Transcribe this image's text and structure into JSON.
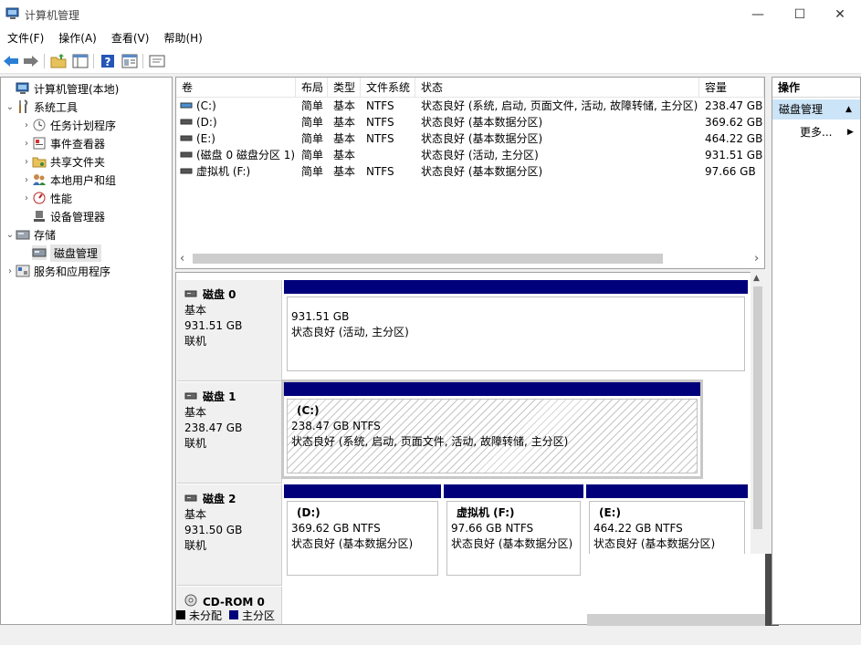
{
  "window": {
    "title": "计算机管理",
    "minimize_glyph": "—",
    "maximize_glyph": "☐",
    "close_glyph": "✕"
  },
  "menu": [
    "文件(F)",
    "操作(A)",
    "查看(V)",
    "帮助(H)"
  ],
  "toolbar": {
    "icons": [
      "back-arrow-icon",
      "forward-arrow-icon",
      "up-folder-icon",
      "show-hide-tree-icon",
      "help-icon",
      "properties-icon",
      "console-icon"
    ]
  },
  "tree": [
    {
      "label": "计算机管理(本地)",
      "chev": "",
      "icon": "computer-management-icon"
    },
    {
      "label": "系统工具",
      "chev": "⌄",
      "icon": "tools-icon"
    },
    {
      "label": "任务计划程序",
      "chev": "›",
      "icon": "clock-icon"
    },
    {
      "label": "事件查看器",
      "chev": "›",
      "icon": "event-viewer-icon"
    },
    {
      "label": "共享文件夹",
      "chev": "›",
      "icon": "shared-folder-icon"
    },
    {
      "label": "本地用户和组",
      "chev": "›",
      "icon": "users-icon"
    },
    {
      "label": "性能",
      "chev": "›",
      "icon": "performance-icon"
    },
    {
      "label": "设备管理器",
      "chev": "",
      "icon": "device-manager-icon"
    },
    {
      "label": "存储",
      "chev": "⌄",
      "icon": "storage-icon"
    },
    {
      "label": "磁盘管理",
      "chev": "",
      "icon": "disk-management-icon"
    },
    {
      "label": "服务和应用程序",
      "chev": "›",
      "icon": "services-icon"
    }
  ],
  "volumes": {
    "headers": [
      "卷",
      "布局",
      "类型",
      "文件系统",
      "状态",
      "容量"
    ],
    "rows": [
      [
        "(C:)",
        "简单",
        "基本",
        "NTFS",
        "状态良好 (系统, 启动, 页面文件, 活动, 故障转储, 主分区)",
        "238.47 GB"
      ],
      [
        "(D:)",
        "简单",
        "基本",
        "NTFS",
        "状态良好 (基本数据分区)",
        "369.62 GB"
      ],
      [
        "(E:)",
        "简单",
        "基本",
        "NTFS",
        "状态良好 (基本数据分区)",
        "464.22 GB"
      ],
      [
        "(磁盘 0 磁盘分区 1)",
        "简单",
        "基本",
        "",
        "状态良好 (活动, 主分区)",
        "931.51 GB"
      ],
      [
        "虚拟机 (F:)",
        "简单",
        "基本",
        "NTFS",
        "状态良好 (基本数据分区)",
        "97.66 GB"
      ]
    ],
    "scroll_left": "‹",
    "scroll_right": "›"
  },
  "disks": [
    {
      "name": "磁盘 0",
      "type": "基本",
      "size": "931.51 GB",
      "status": "联机",
      "partitions": [
        {
          "name": "",
          "size": "931.51 GB",
          "status": "状态良好 (活动, 主分区)"
        }
      ]
    },
    {
      "name": "磁盘 1",
      "type": "基本",
      "size": "238.47 GB",
      "status": "联机",
      "partitions": [
        {
          "name": "(C:)",
          "size": "238.47 GB NTFS",
          "status": "状态良好 (系统, 启动, 页面文件, 活动, 故障转储, 主分区)"
        }
      ]
    },
    {
      "name": "磁盘 2",
      "type": "基本",
      "size": "931.50 GB",
      "status": "联机",
      "partitions": [
        {
          "name": "(D:)",
          "size": "369.62 GB NTFS",
          "status": "状态良好 (基本数据分区)"
        },
        {
          "name": "虚拟机  (F:)",
          "size": "97.66 GB NTFS",
          "status": "状态良好 (基本数据分区)"
        },
        {
          "name": "(E:)",
          "size": "464.22 GB NTFS",
          "status": "状态良好 (基本数据分区)"
        }
      ]
    },
    {
      "name": "CD-ROM 0"
    }
  ],
  "legend": [
    {
      "label": "未分配",
      "color": "#000000"
    },
    {
      "label": "主分区",
      "color": "#00007b"
    }
  ],
  "actions": {
    "header": "操作",
    "group": "磁盘管理",
    "more": "更多...",
    "more_arrow": "▶",
    "group_arrow": "▲"
  },
  "colors": {
    "primary_partition": "#00007b",
    "selection": "#cce4f7"
  }
}
